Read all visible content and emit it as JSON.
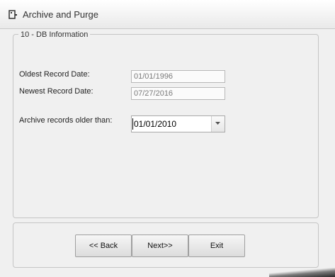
{
  "window": {
    "title": "Archive and Purge",
    "icon": "archive-window-icon"
  },
  "db_info": {
    "legend": "10 - DB Information",
    "oldest_label": "Oldest Record Date:",
    "oldest_value": "01/01/1996",
    "newest_label": "Newest Record Date:",
    "newest_value": "07/27/2016",
    "archive_label": "Archive records older than:",
    "archive_value": "01/01/2010"
  },
  "buttons": {
    "back": "<< Back",
    "next": "Next>>",
    "exit": "Exit"
  },
  "colors": {
    "background": "#f0f0f0",
    "border": "#c5c5c5",
    "readonly_text": "#7a7a7a"
  }
}
